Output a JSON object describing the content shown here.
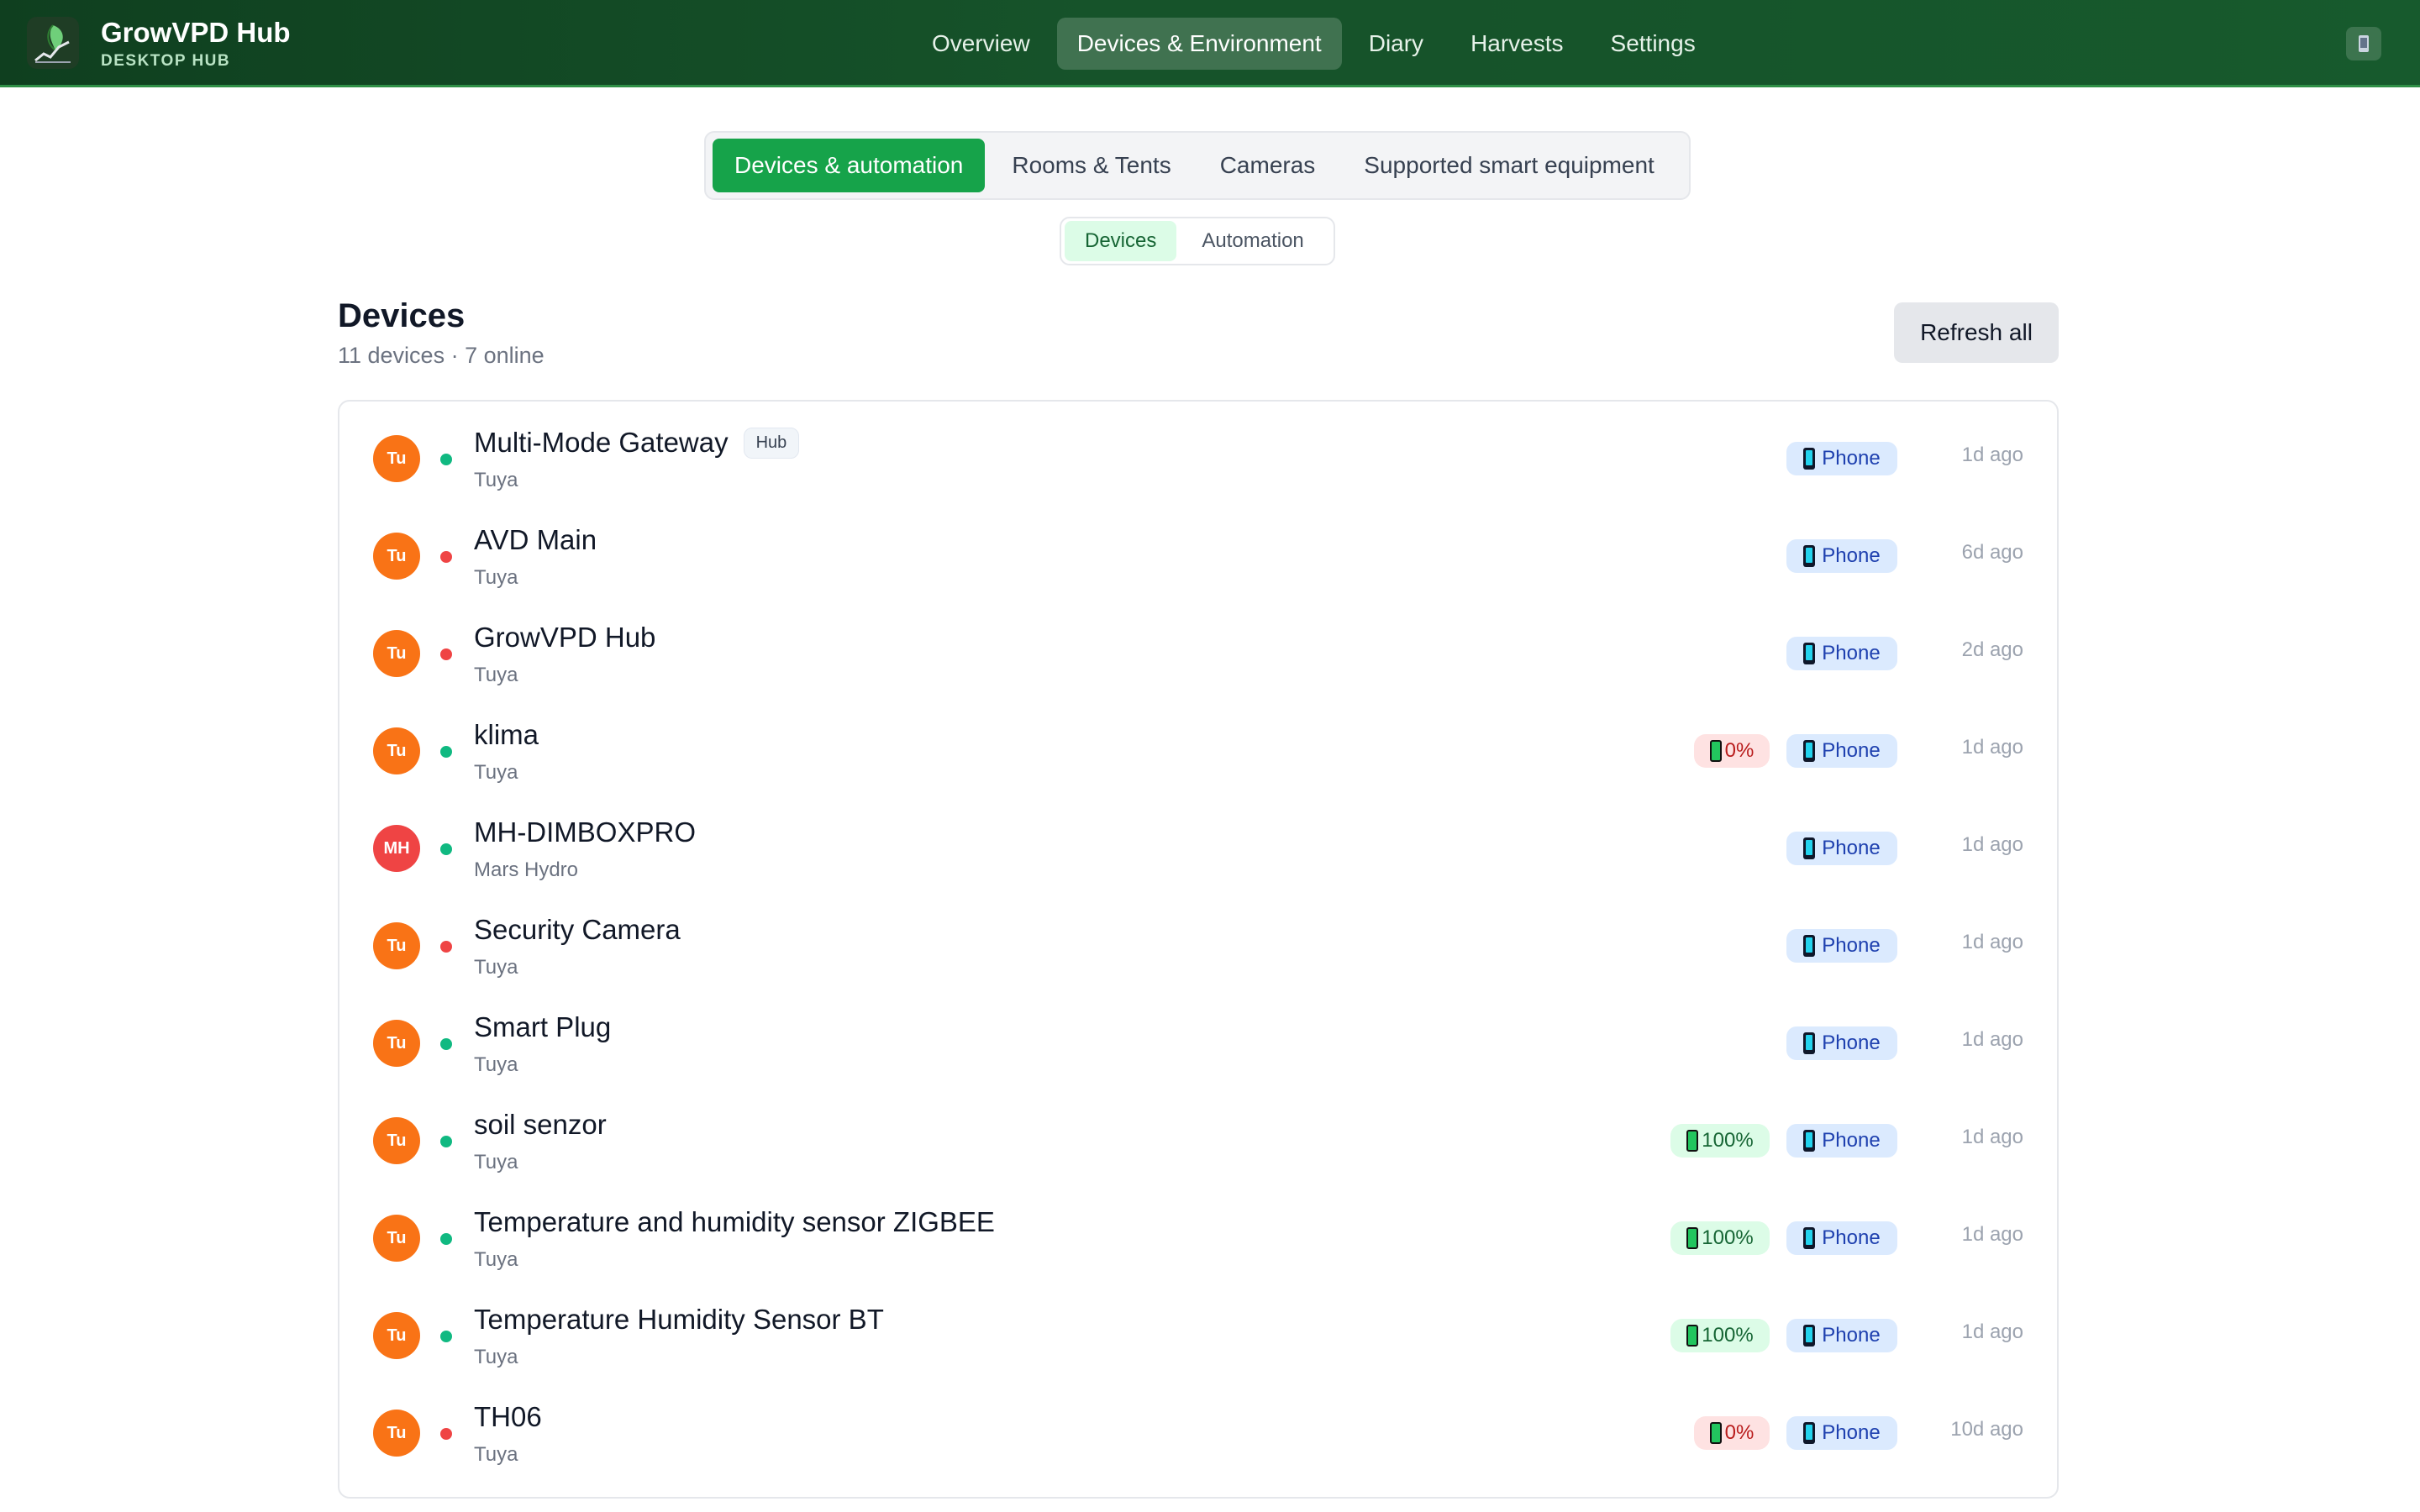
{
  "app": {
    "title": "GrowVPD Hub",
    "subtitle": "DESKTOP HUB",
    "colors": {
      "primary": "#16a34a",
      "header": "#16532a",
      "online": "#10b981",
      "offline": "#ef4444"
    }
  },
  "nav": {
    "items": [
      {
        "label": "Overview"
      },
      {
        "label": "Devices & Environment"
      },
      {
        "label": "Diary"
      },
      {
        "label": "Harvests"
      },
      {
        "label": "Settings"
      }
    ],
    "active": "Devices & Environment",
    "right_icon": "phone-icon"
  },
  "tabs": {
    "items": [
      {
        "label": "Devices & automation"
      },
      {
        "label": "Rooms & Tents"
      },
      {
        "label": "Cameras"
      },
      {
        "label": "Supported smart equipment"
      }
    ],
    "active": "Devices & automation"
  },
  "subtabs": {
    "items": [
      {
        "label": "Devices"
      },
      {
        "label": "Automation"
      }
    ],
    "active": "Devices"
  },
  "devices_section": {
    "title": "Devices",
    "summary": "11 devices · 7 online",
    "refresh_label": "Refresh all"
  },
  "devices": [
    {
      "initials": "Tu",
      "status": "online",
      "name": "Multi-Mode Gateway",
      "tag": "Hub",
      "vendor": "Tuya",
      "battery": null,
      "source": "Phone",
      "last_seen": "1d ago"
    },
    {
      "initials": "Tu",
      "status": "offline",
      "name": "AVD Main",
      "tag": null,
      "vendor": "Tuya",
      "battery": null,
      "source": "Phone",
      "last_seen": "6d ago"
    },
    {
      "initials": "Tu",
      "status": "offline",
      "name": "GrowVPD Hub",
      "tag": null,
      "vendor": "Tuya",
      "battery": null,
      "source": "Phone",
      "last_seen": "2d ago"
    },
    {
      "initials": "Tu",
      "status": "online",
      "name": "klima",
      "tag": null,
      "vendor": "Tuya",
      "battery": "0%",
      "source": "Phone",
      "last_seen": "1d ago"
    },
    {
      "initials": "MH",
      "status": "online",
      "name": "MH-DIMBOXPRO",
      "tag": null,
      "vendor": "Mars Hydro",
      "battery": null,
      "source": "Phone",
      "last_seen": "1d ago"
    },
    {
      "initials": "Tu",
      "status": "offline",
      "name": "Security Camera",
      "tag": null,
      "vendor": "Tuya",
      "battery": null,
      "source": "Phone",
      "last_seen": "1d ago"
    },
    {
      "initials": "Tu",
      "status": "online",
      "name": "Smart Plug",
      "tag": null,
      "vendor": "Tuya",
      "battery": null,
      "source": "Phone",
      "last_seen": "1d ago"
    },
    {
      "initials": "Tu",
      "status": "online",
      "name": "soil senzor",
      "tag": null,
      "vendor": "Tuya",
      "battery": "100%",
      "source": "Phone",
      "last_seen": "1d ago"
    },
    {
      "initials": "Tu",
      "status": "online",
      "name": "Temperature and humidity sensor ZIGBEE",
      "tag": null,
      "vendor": "Tuya",
      "battery": "100%",
      "source": "Phone",
      "last_seen": "1d ago"
    },
    {
      "initials": "Tu",
      "status": "online",
      "name": "Temperature Humidity Sensor BT",
      "tag": null,
      "vendor": "Tuya",
      "battery": "100%",
      "source": "Phone",
      "last_seen": "1d ago"
    },
    {
      "initials": "Tu",
      "status": "offline",
      "name": "TH06",
      "tag": null,
      "vendor": "Tuya",
      "battery": "0%",
      "source": "Phone",
      "last_seen": "10d ago"
    }
  ]
}
